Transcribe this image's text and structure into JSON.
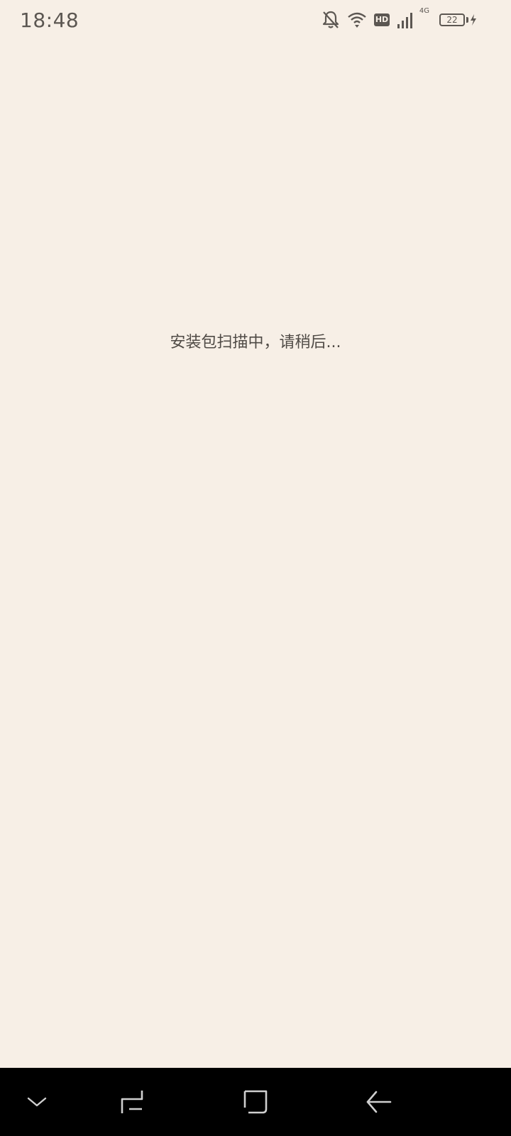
{
  "status_bar": {
    "time": "18:48",
    "network_type": "4G",
    "hd_label": "HD",
    "battery_level": "22",
    "icons": [
      "bell-off-icon",
      "wifi-icon",
      "hd-badge",
      "signal-icon",
      "battery-icon",
      "charging-icon"
    ]
  },
  "main": {
    "message": "安装包扫描中，请稍后..."
  },
  "navigation_bar": {
    "buttons": [
      {
        "name": "hide-nav-button",
        "icon": "chevron-down-icon"
      },
      {
        "name": "recents-button",
        "icon": "recents-icon"
      },
      {
        "name": "home-button",
        "icon": "home-square-icon"
      },
      {
        "name": "back-button",
        "icon": "back-arrow-icon"
      }
    ]
  },
  "colors": {
    "background": "#f7efe6",
    "status_text": "#5c5752",
    "message_text": "#4f4a45",
    "nav_background": "#000000",
    "nav_icon": "#cfcfcf"
  }
}
